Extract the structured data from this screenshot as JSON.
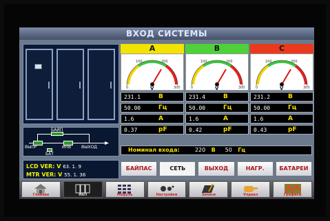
{
  "title": "ВХОД СИСТЕМЫ",
  "colors": {
    "phase_a": "#f2e300",
    "phase_b": "#4fd13c",
    "phase_c": "#ea3a1e",
    "unit": "#f7e000",
    "tab_text": "#b01616"
  },
  "diagram": {
    "bypass": "БАЙП",
    "rectifier": "ВЫПР",
    "inverter": "ИНВ",
    "output": "ВЫХОД",
    "battery": "БАТ"
  },
  "version": {
    "lcd_label": "LCD VER: V",
    "lcd_nums": "63.    1.    9",
    "mtr_label": "MTR VER: V",
    "mtr_nums": "55.    1.   36"
  },
  "phases": [
    {
      "name": "A",
      "voltage": "231.1",
      "voltage_unit": "В",
      "freq": "50.00",
      "freq_unit": "Гц",
      "current": "1.6",
      "current_unit": "A",
      "pf": "0.37",
      "pf_unit": "pF",
      "gauge_unit": "V",
      "gauge_ticks": [
        "0",
        "100",
        "200",
        "300"
      ]
    },
    {
      "name": "B",
      "voltage": "231.4",
      "voltage_unit": "В",
      "freq": "50.00",
      "freq_unit": "Гц",
      "current": "1.6",
      "current_unit": "A",
      "pf": "0.42",
      "pf_unit": "pF",
      "gauge_unit": "V",
      "gauge_ticks": [
        "0",
        "100",
        "200",
        "300"
      ]
    },
    {
      "name": "C",
      "voltage": "231.2",
      "voltage_unit": "В",
      "freq": "50.00",
      "freq_unit": "Гц",
      "current": "1.6",
      "current_unit": "A",
      "pf": "0.43",
      "pf_unit": "pF",
      "gauge_unit": "V",
      "gauge_ticks": [
        "0",
        "100",
        "200",
        "300"
      ]
    }
  ],
  "nominal": {
    "label": "Номинал входа:",
    "voltage": "220",
    "voltage_unit": "В",
    "freq": "50",
    "freq_unit": "Гц"
  },
  "tabs": [
    {
      "label": "БАЙПАС"
    },
    {
      "label": "СЕТЬ"
    },
    {
      "label": "ВЫХОД"
    },
    {
      "label": "НАГР."
    },
    {
      "label": "БАТАРЕИ"
    }
  ],
  "nav": [
    {
      "label": "Главная",
      "icon": "home-icon"
    },
    {
      "label": "ИБП",
      "icon": "ups-icon"
    },
    {
      "label": "Модуль",
      "icon": "module-icon"
    },
    {
      "label": "Настройки",
      "icon": "settings-icon"
    },
    {
      "label": "Записи",
      "icon": "records-icon"
    },
    {
      "label": "Управл",
      "icon": "control-icon"
    },
    {
      "label": "Графики",
      "icon": "graph-icon"
    }
  ]
}
